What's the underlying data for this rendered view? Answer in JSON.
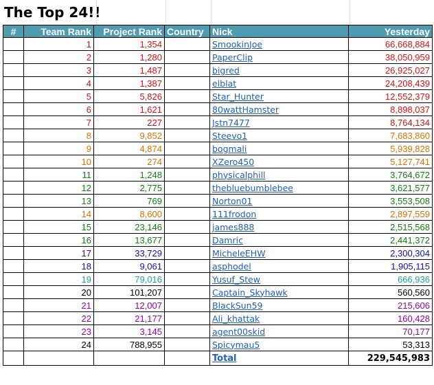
{
  "title": "The Top 24!!",
  "headers": {
    "hash": "#",
    "team_rank": "Team Rank",
    "project_rank": "Project Rank",
    "country": "Country",
    "nick": "Nick",
    "yesterday": "Yesterday"
  },
  "colors": {
    "header_bg": "#4f9bb0",
    "link": "#1f5fbf",
    "red": "#e01010",
    "orange": "#e07000",
    "green": "#108010",
    "blue": "#1010c0",
    "teal": "#20a0a0",
    "black": "#000000",
    "purple": "#a000a0"
  },
  "rows": [
    {
      "team_rank": "1",
      "project_rank": "1,354",
      "nick": "SmookinJoe",
      "yesterday": "66,668,884",
      "color": "red"
    },
    {
      "team_rank": "2",
      "project_rank": "1,280",
      "nick": "PaperClip",
      "yesterday": "38,050,959",
      "color": "red"
    },
    {
      "team_rank": "3",
      "project_rank": "1,487",
      "nick": "bigred",
      "yesterday": "26,925,027",
      "color": "red"
    },
    {
      "team_rank": "4",
      "project_rank": "1,387",
      "nick": "elblat",
      "yesterday": "24,208,439",
      "color": "red"
    },
    {
      "team_rank": "5",
      "project_rank": "5,826",
      "nick": "Star_Hunter",
      "yesterday": "12,552,379",
      "color": "red"
    },
    {
      "team_rank": "6",
      "project_rank": "1,621",
      "nick": "80wattHamster",
      "yesterday": "8,898,037",
      "color": "red"
    },
    {
      "team_rank": "7",
      "project_rank": "227",
      "nick": "Jstn7477",
      "yesterday": "8,764,134",
      "color": "red"
    },
    {
      "team_rank": "8",
      "project_rank": "9,852",
      "nick": "Steevo1",
      "yesterday": "7,683,860",
      "color": "orange"
    },
    {
      "team_rank": "9",
      "project_rank": "4,874",
      "nick": "bogmali",
      "yesterday": "5,939,828",
      "color": "orange"
    },
    {
      "team_rank": "10",
      "project_rank": "274",
      "nick": "XZero450",
      "yesterday": "5,127,741",
      "color": "orange"
    },
    {
      "team_rank": "11",
      "project_rank": "1,248",
      "nick": "physicalphill",
      "yesterday": "3,764,672",
      "color": "green"
    },
    {
      "team_rank": "12",
      "project_rank": "2,775",
      "nick": "thebluebumblebee",
      "yesterday": "3,621,577",
      "color": "green"
    },
    {
      "team_rank": "13",
      "project_rank": "769",
      "nick": "Norton01",
      "yesterday": "3,553,508",
      "color": "green"
    },
    {
      "team_rank": "14",
      "project_rank": "8,600",
      "nick": "111frodon",
      "yesterday": "2,897,559",
      "color": "orange"
    },
    {
      "team_rank": "15",
      "project_rank": "23,146",
      "nick": "james888",
      "yesterday": "2,515,568",
      "color": "green"
    },
    {
      "team_rank": "16",
      "project_rank": "13,677",
      "nick": "Damric",
      "yesterday": "2,441,372",
      "color": "green"
    },
    {
      "team_rank": "17",
      "project_rank": "33,729",
      "nick": "MicheleEHW",
      "yesterday": "2,300,304",
      "color": "blue"
    },
    {
      "team_rank": "18",
      "project_rank": "9,061",
      "nick": "asphodel",
      "yesterday": "1,905,115",
      "color": "blue"
    },
    {
      "team_rank": "19",
      "project_rank": "79,016",
      "nick": "Yusuf_Stew",
      "yesterday": "666,936",
      "color": "teal"
    },
    {
      "team_rank": "20",
      "project_rank": "101,207",
      "nick": "Captain_Skyhawk",
      "yesterday": "560,560",
      "color": "black"
    },
    {
      "team_rank": "21",
      "project_rank": "12,007",
      "nick": "BlackSun59",
      "yesterday": "215,606",
      "color": "purple"
    },
    {
      "team_rank": "22",
      "project_rank": "21,177",
      "nick": "Ali_khattak",
      "yesterday": "160,428",
      "color": "purple"
    },
    {
      "team_rank": "23",
      "project_rank": "3,145",
      "nick": "agent00skid",
      "yesterday": "70,177",
      "color": "purple"
    },
    {
      "team_rank": "24",
      "project_rank": "788,955",
      "nick": "Spicymau5",
      "yesterday": "53,313",
      "color": "black"
    }
  ],
  "total": {
    "label": "Total",
    "value": "229,545,983"
  }
}
